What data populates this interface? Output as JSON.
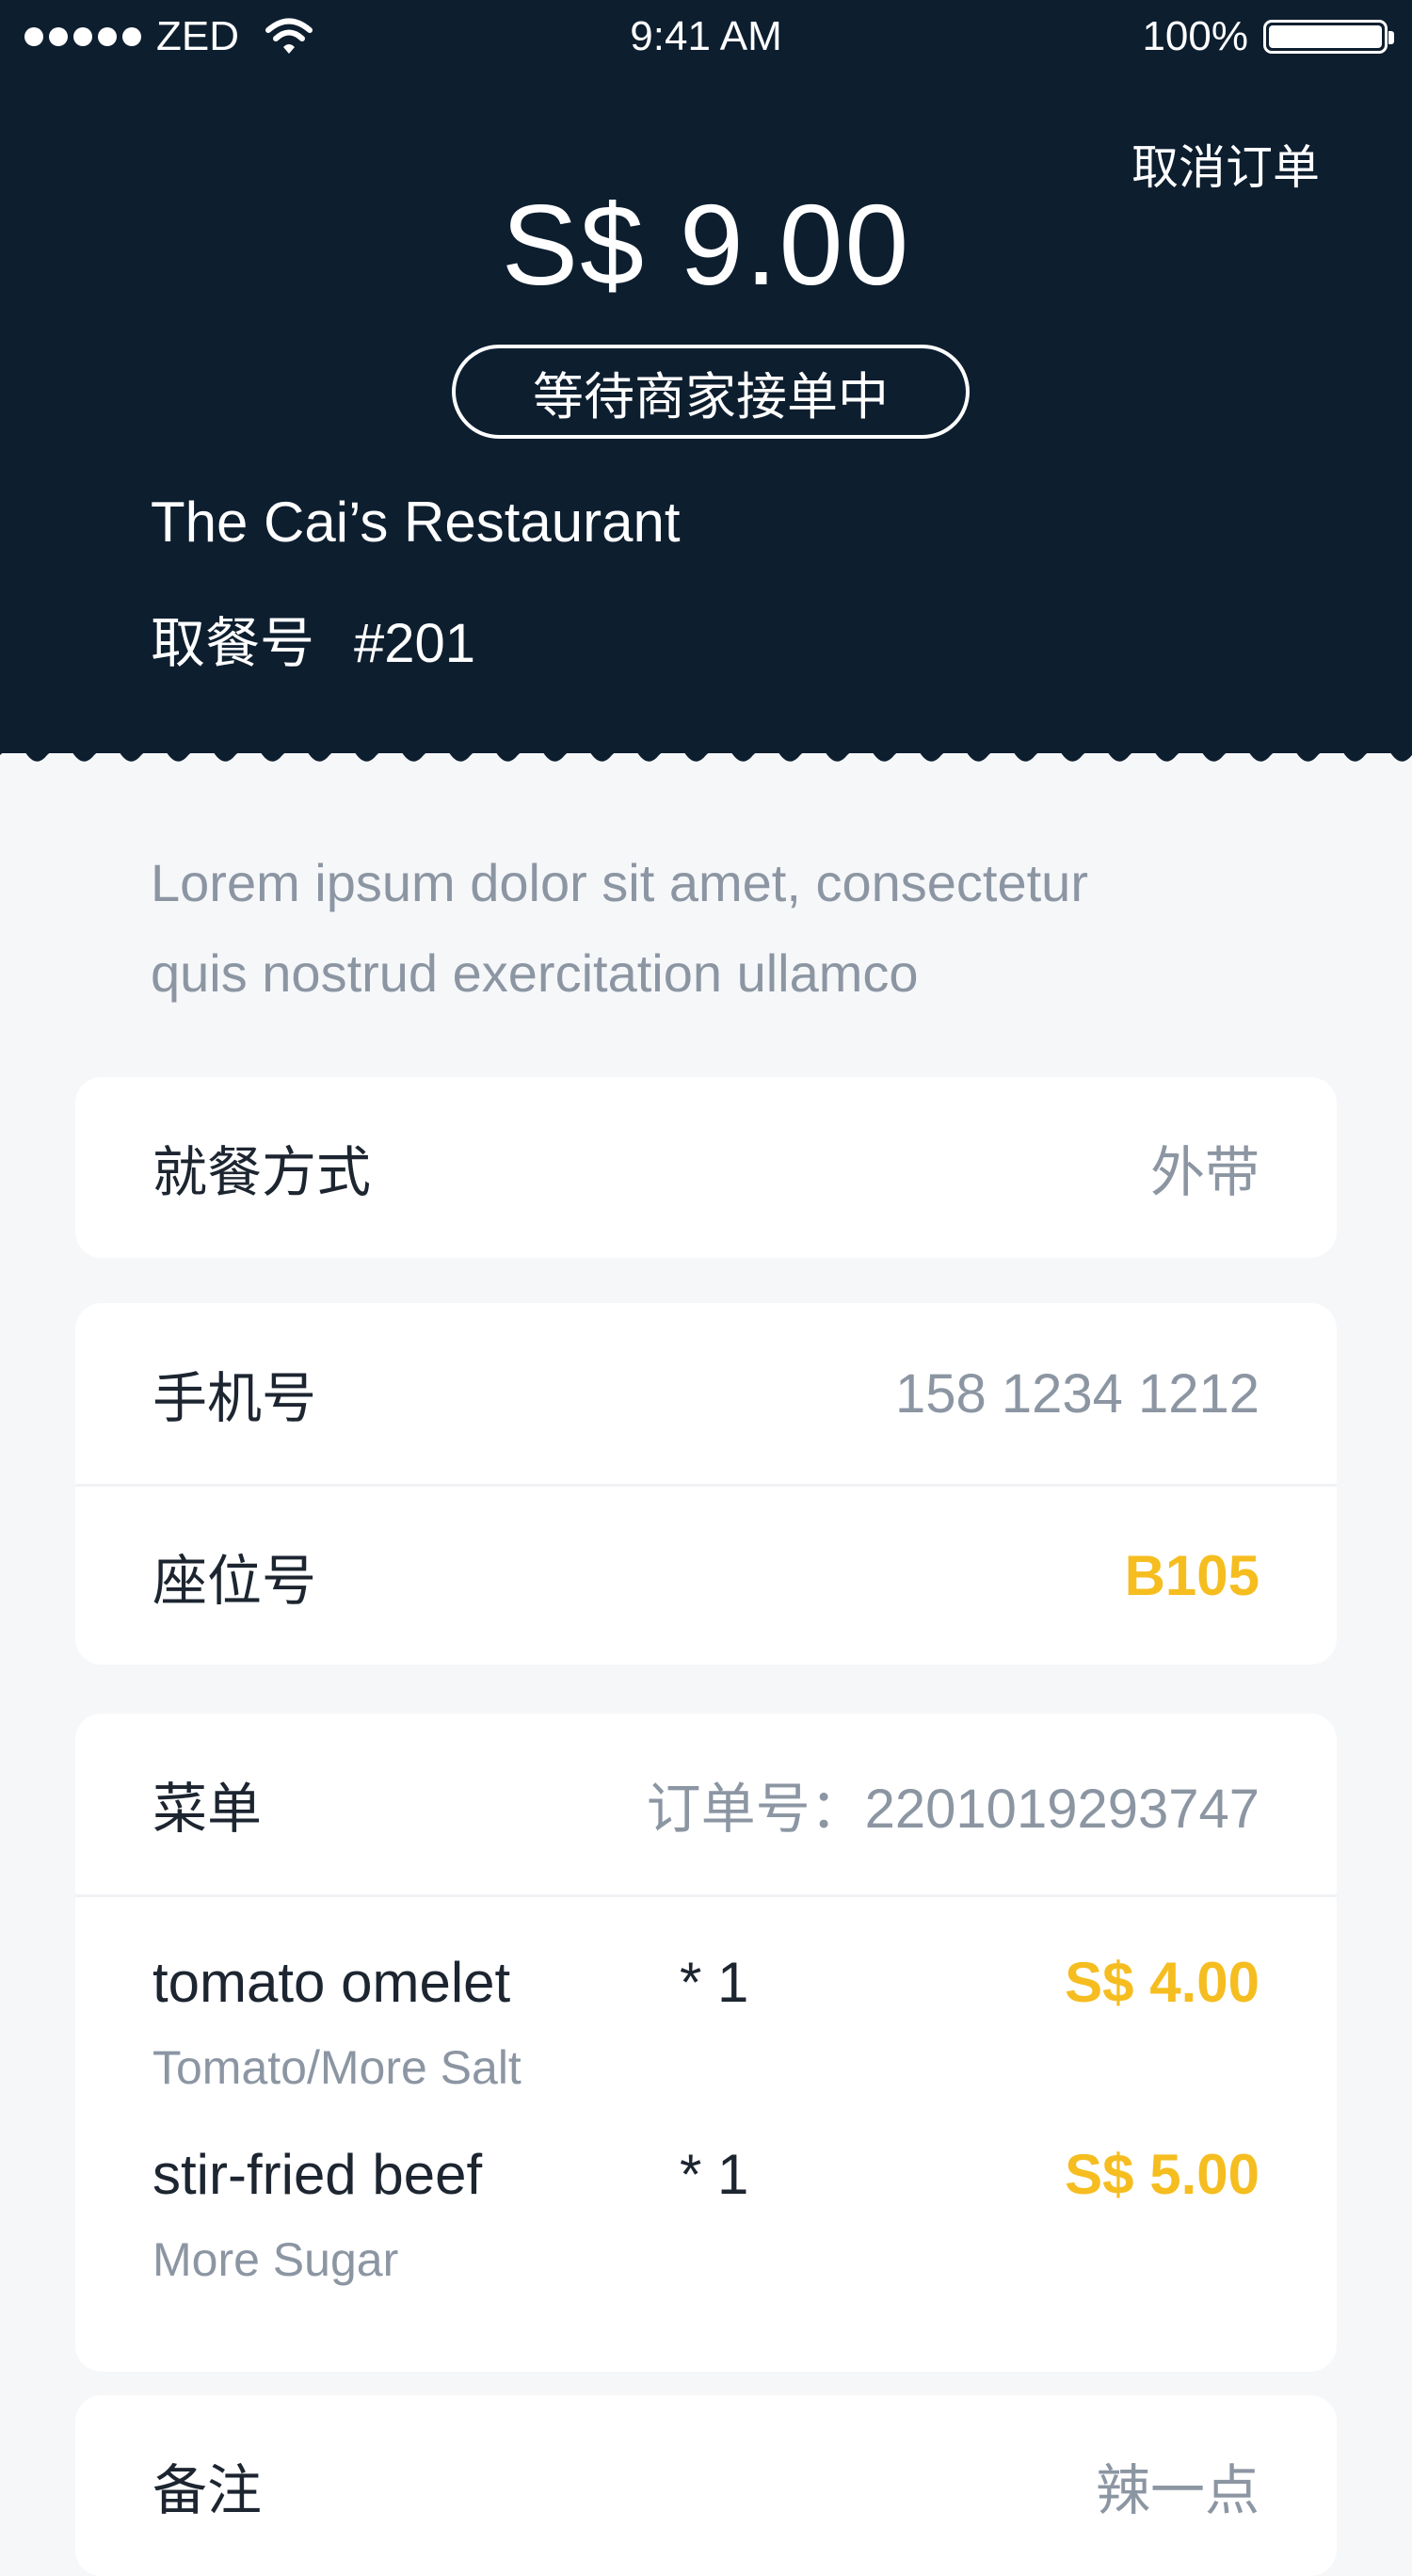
{
  "status_bar": {
    "carrier": "ZED",
    "time": "9:41 AM",
    "battery": "100%"
  },
  "header": {
    "cancel_label": "取消订单",
    "amount": "S$ 9.00",
    "status": "等待商家接单中",
    "restaurant": "The Cai’s Restaurant",
    "pickup_label": "取餐号",
    "pickup_number": "#201"
  },
  "intro": {
    "line1": "Lorem ipsum dolor sit amet, consectetur",
    "line2": "quis nostrud exercitation ullamco"
  },
  "dining": {
    "label": "就餐方式",
    "value": "外带"
  },
  "contact": {
    "phone_label": "手机号",
    "phone_value": "158 1234 1212",
    "seat_label": "座位号",
    "seat_value": "B105"
  },
  "menu": {
    "label": "菜单",
    "order_label": "订单号：",
    "order_number": "2201019293747",
    "items": [
      {
        "name": "tomato omelet",
        "qty": "* 1",
        "price": "S$ 4.00",
        "note": "Tomato/More Salt"
      },
      {
        "name": "stir-fried beef",
        "qty": "* 1",
        "price": "S$ 5.00",
        "note": "More Sugar"
      }
    ]
  },
  "remark": {
    "label": "备注",
    "value": "辣一点"
  },
  "colors": {
    "header_bg": "#0d1e2f",
    "accent_yellow": "#f5bd1f",
    "muted_text": "#8c96a3",
    "page_bg": "#f6f7f9"
  }
}
